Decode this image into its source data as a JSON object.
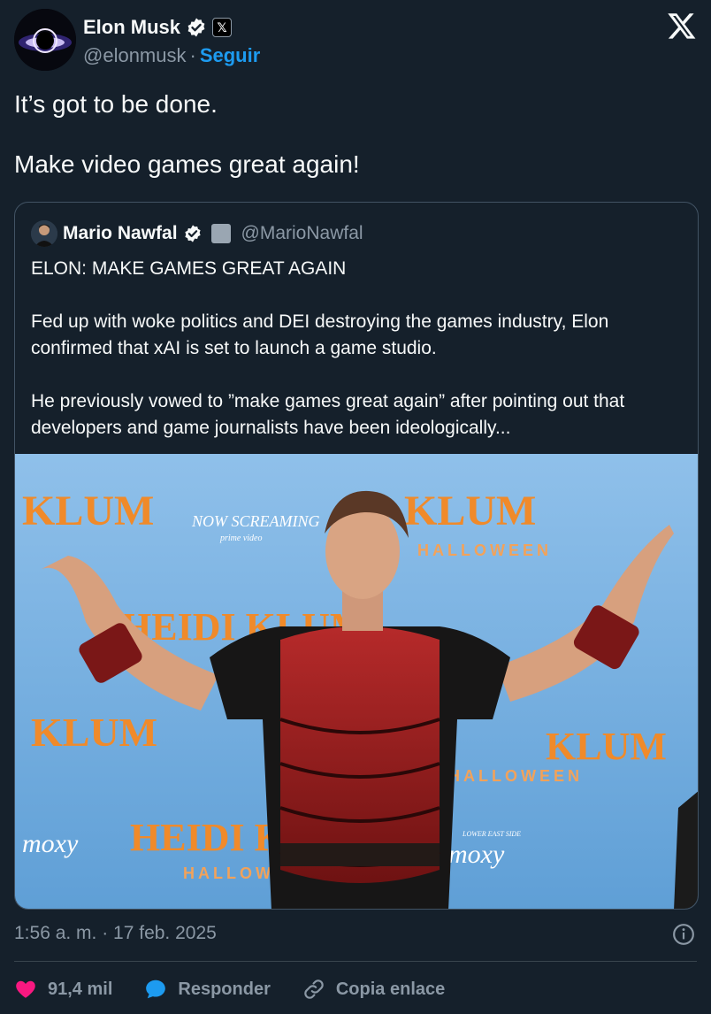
{
  "author": {
    "name": "Elon Musk",
    "handle": "@elonmusk",
    "separator": "·",
    "follow_label": "Seguir",
    "affiliate_badge": "x-affiliate-icon",
    "verified_icon": "verified-badge-icon"
  },
  "brand_icon": "x-logo-icon",
  "tweet": {
    "paragraphs": [
      "It’s got to be done.",
      "Make video games great again!"
    ]
  },
  "quote": {
    "name": "Mario Nawfal",
    "handle": "@MarioNawfal",
    "paragraphs": [
      "ELON: MAKE GAMES GREAT AGAIN",
      "Fed up with woke politics and DEI destroying the games industry, Elon confirmed that xAI is set to launch a game studio.",
      "He previously vowed to ”make games great again” after pointing out that developers and game journalists have been ideologically..."
    ],
    "image": {
      "backdrop_words": [
        "KLUM",
        "HEIDI KLUM",
        "HALLOWEEN",
        "NOW SCREAMING",
        "prime video",
        "moxy",
        "LOWER EAST SIDE"
      ]
    }
  },
  "footer": {
    "timestamp": "1:56 a. m. · 17 feb. 2025",
    "info_icon": "info-icon"
  },
  "actions": {
    "like_count": "91,4 mil",
    "reply_label": "Responder",
    "copy_link_label": "Copia enlace"
  },
  "colors": {
    "background": "#15202b",
    "accent": "#1d9bf0",
    "like": "#f91880",
    "muted": "#8b98a5"
  }
}
